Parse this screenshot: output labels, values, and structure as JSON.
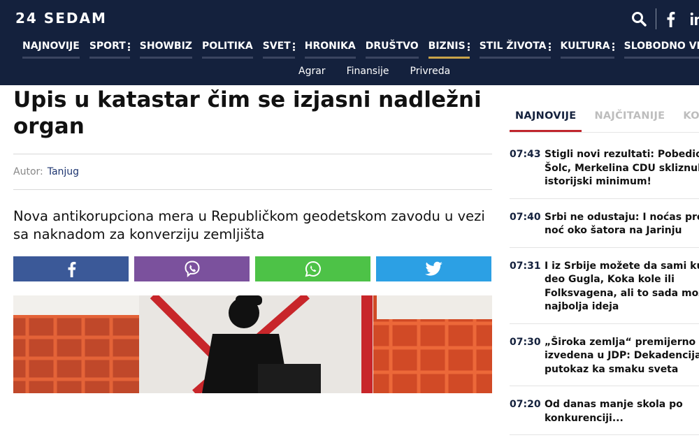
{
  "header": {
    "logo": "24 SEDAM",
    "nav": [
      {
        "label": "NAJNOVIJE",
        "dots": false,
        "active": false
      },
      {
        "label": "SPORT",
        "dots": true,
        "active": false
      },
      {
        "label": "SHOWBIZ",
        "dots": false,
        "active": false
      },
      {
        "label": "POLITIKA",
        "dots": false,
        "active": false
      },
      {
        "label": "SVET",
        "dots": true,
        "active": false
      },
      {
        "label": "HRONIKA",
        "dots": false,
        "active": false
      },
      {
        "label": "DRUŠTVO",
        "dots": false,
        "active": false
      },
      {
        "label": "BIZNIS",
        "dots": true,
        "active": true
      },
      {
        "label": "STIL ŽIVOTA",
        "dots": true,
        "active": false
      },
      {
        "label": "KULTURA",
        "dots": true,
        "active": false
      },
      {
        "label": "SLOBODNO VREME",
        "dots": true,
        "active": false
      }
    ],
    "subnav": [
      "Agrar",
      "Finansije",
      "Privreda"
    ],
    "icons": [
      "search-icon",
      "facebook-icon",
      "linkedin-icon"
    ]
  },
  "article": {
    "title": "Upis u katastar čim se izjasni nadležni organ",
    "author_label": "Autor:",
    "author_name": "Tanjug",
    "lead": "Nova antikorupciona mera u Republičkom geodetskom zavodu u vezi sa naknadom za konverziju zemljišta",
    "share": [
      {
        "name": "facebook",
        "color": "#3b5998"
      },
      {
        "name": "viber",
        "color": "#7b519d"
      },
      {
        "name": "whatsapp",
        "color": "#4dc247"
      },
      {
        "name": "twitter",
        "color": "#2ca0e4"
      }
    ]
  },
  "sidebar": {
    "tabs": [
      "NAJNOVIJE",
      "NAJČITANIJE",
      "KOME"
    ],
    "news": [
      {
        "time": "07:43",
        "title": "Stigli novi rezultati: Pobedio\nŠolc, Merkelina CDU skliznula\nistorijski minimum!"
      },
      {
        "time": "07:40",
        "title": "Srbi ne odustaju: I noćas pro\nnoć oko šatora na Jarinju"
      },
      {
        "time": "07:31",
        "title": "I iz Srbije možete da sami ku\ndeo Gugla, Koka kole ili\nFolksvagena, ali to sada mož\nnajbolja ideja"
      },
      {
        "time": "07:30",
        "title": "„Široka zemlja“ premijerno\nizvedena u JDP: Dekadencija\nputokaz ka smaku sveta"
      },
      {
        "time": "07:20",
        "title": "Od danas manje skola po\nkonkurenciji..."
      }
    ]
  },
  "colors": {
    "header_bg": "#14213d",
    "active_underline": "#c9a44a",
    "tab_active": "#c0262d"
  }
}
